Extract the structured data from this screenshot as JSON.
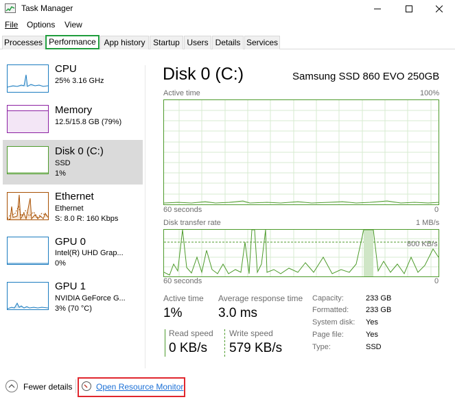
{
  "window": {
    "title": "Task Manager",
    "minimize": "—",
    "maximize": "☐",
    "close": "✕"
  },
  "menu": {
    "file": "File",
    "options": "Options",
    "view": "View"
  },
  "tabs": [
    "Processes",
    "Performance",
    "App history",
    "Startup",
    "Users",
    "Details",
    "Services"
  ],
  "active_tab": "Performance",
  "sidebar": [
    {
      "title": "CPU",
      "lines": [
        "25%  3.16 GHz"
      ],
      "color": "#1a7bbf"
    },
    {
      "title": "Memory",
      "lines": [
        "12.5/15.8 GB (79%)"
      ],
      "color": "#8b1fa2"
    },
    {
      "title": "Disk 0 (C:)",
      "lines": [
        "SSD",
        "1%"
      ],
      "color": "#4c9a2a"
    },
    {
      "title": "Ethernet",
      "lines": [
        "Ethernet",
        "S: 8.0  R: 160 Kbps"
      ],
      "color": "#a74f01"
    },
    {
      "title": "GPU 0",
      "lines": [
        "Intel(R) UHD Grap...",
        "0%"
      ],
      "color": "#1a7bbf"
    },
    {
      "title": "GPU 1",
      "lines": [
        "NVIDIA GeForce G...",
        "3% (70 °C)"
      ],
      "color": "#1a7bbf"
    }
  ],
  "main": {
    "title": "Disk 0 (C:)",
    "model": "Samsung SSD 860 EVO 250GB",
    "graph1": {
      "label": "Active time",
      "max": "100%",
      "xlabel": "60 seconds",
      "min": "0"
    },
    "graph2": {
      "label": "Disk transfer rate",
      "max": "1 MB/s",
      "mid": "800 KB/s",
      "xlabel": "60 seconds",
      "min": "0"
    },
    "stats": {
      "active_time_label": "Active time",
      "active_time": "1%",
      "avg_resp_label": "Average response time",
      "avg_resp": "3.0 ms",
      "read_label": "Read speed",
      "read": "0 KB/s",
      "write_label": "Write speed",
      "write": "579 KB/s"
    },
    "details": [
      {
        "k": "Capacity:",
        "v": "233 GB"
      },
      {
        "k": "Formatted:",
        "v": "233 GB"
      },
      {
        "k": "System disk:",
        "v": "Yes"
      },
      {
        "k": "Page file:",
        "v": "Yes"
      },
      {
        "k": "Type:",
        "v": "SSD"
      }
    ]
  },
  "footer": {
    "fewer_details": "Fewer details",
    "open_resource_monitor": "Open Resource Monitor"
  }
}
